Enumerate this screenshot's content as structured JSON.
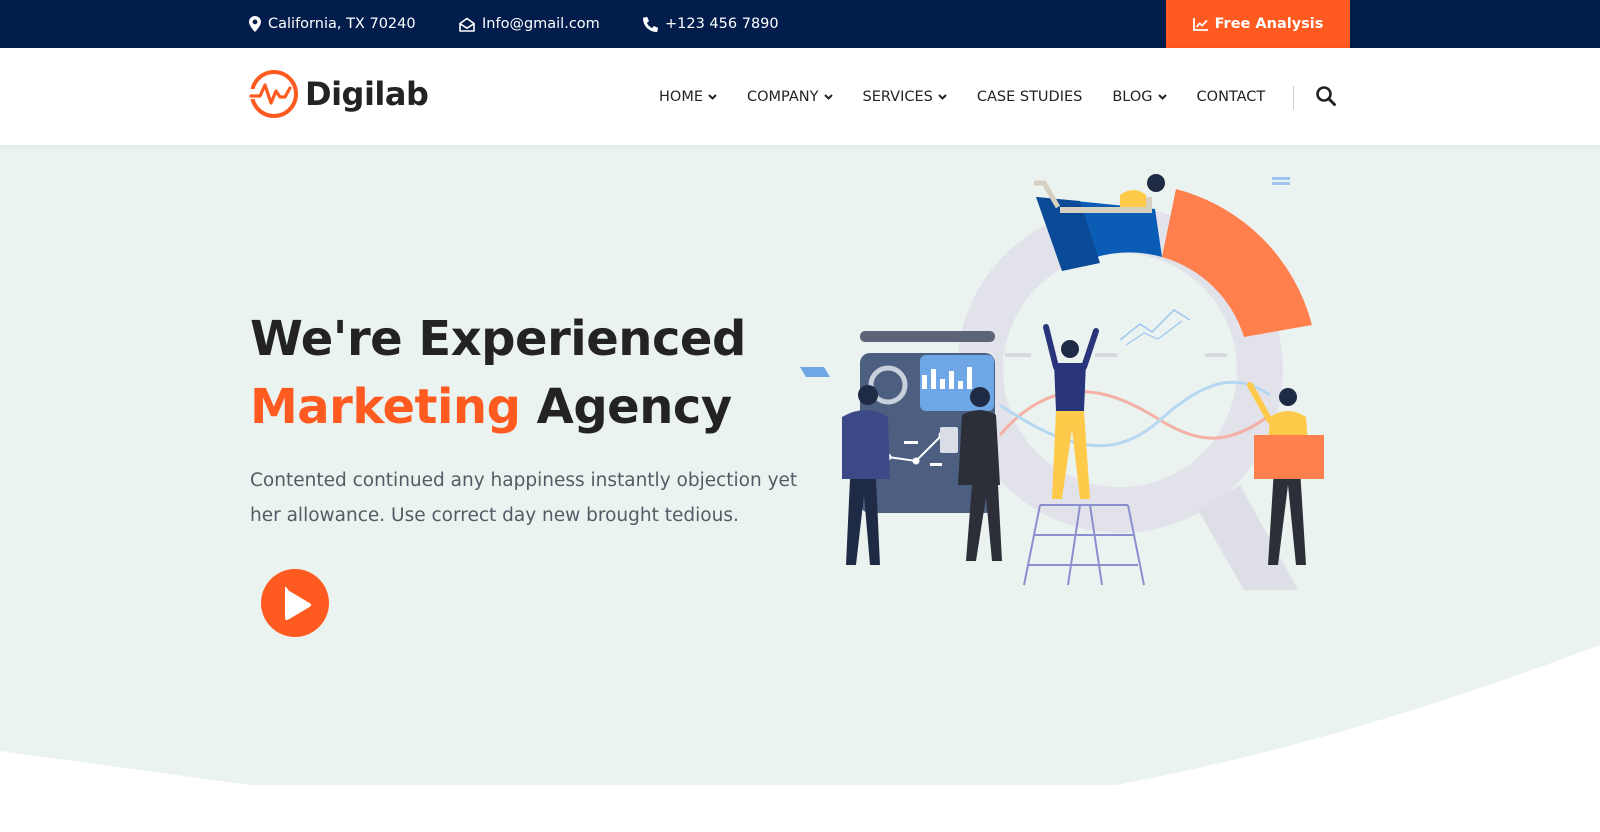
{
  "topbar": {
    "address": "California, TX 70240",
    "email": "Info@gmail.com",
    "phone": "+123 456 7890",
    "cta_label": "Free Analysis"
  },
  "brand": {
    "name": "Digilab"
  },
  "nav": {
    "items": [
      {
        "label": "HOME",
        "dropdown": true
      },
      {
        "label": "COMPANY",
        "dropdown": true
      },
      {
        "label": "SERVICES",
        "dropdown": true
      },
      {
        "label": "CASE STUDIES",
        "dropdown": false
      },
      {
        "label": "BLOG",
        "dropdown": true
      },
      {
        "label": "CONTACT",
        "dropdown": false
      }
    ]
  },
  "hero": {
    "title_line1": "We're Experienced",
    "title_accent": "Marketing",
    "title_rest": "Agency",
    "description": "Contented continued any happiness instantly objection yet her allowance. Use correct day new brought tedious."
  },
  "colors": {
    "topbar_bg": "#021d4b",
    "accent": "#ff5a1f",
    "hero_bg": "#ebf3f0",
    "text_dark": "#232323"
  },
  "icons": [
    "map-pin-icon",
    "envelope-open-icon",
    "phone-icon",
    "chart-line-icon",
    "chevron-down-icon",
    "search-icon",
    "play-icon"
  ]
}
